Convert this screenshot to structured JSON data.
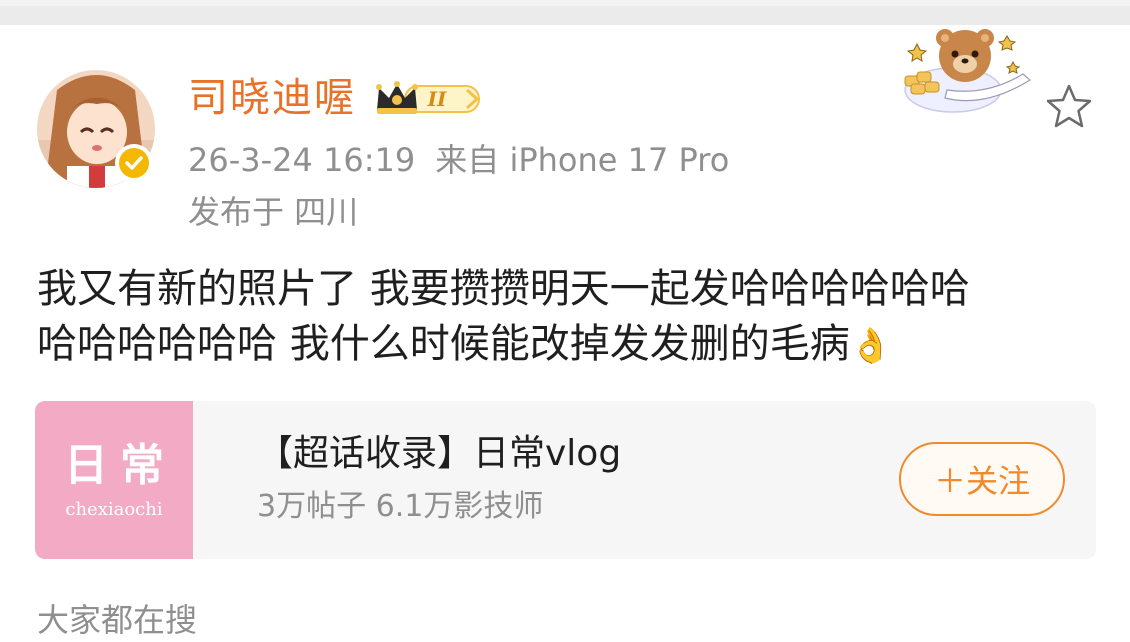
{
  "post": {
    "author": {
      "name": "司晓迪喔",
      "vip_level": "II",
      "verified": true
    },
    "meta": {
      "date": "26-3-24 16:19",
      "source": "来自 iPhone 17 Pro",
      "location": "发布于 四川"
    },
    "content": {
      "line1": "我又有新的照片了 我要攒攒明天一起发哈哈哈哈哈哈",
      "line2": "哈哈哈哈哈哈 我什么时候能改掉发发删的毛病",
      "emoji": "👌"
    },
    "topic": {
      "cover_title": "日常",
      "cover_subtitle": "chexiaochi",
      "name": "【超话收录】日常vlog",
      "stats": "3万帖子 6.1万影技师",
      "follow_label": "＋关注"
    }
  },
  "section": {
    "search_label": "大家都在搜"
  },
  "icons": {
    "star": "star-outline-icon",
    "verified": "verified-badge-icon",
    "vip": "crown-icon"
  },
  "colors": {
    "username": "#e8722a",
    "accent": "#f08a2b",
    "meta_text": "#8f8f8f",
    "body_text": "#1f1f1f",
    "card_bg": "#f6f6f6",
    "cover_bg": "#f3aac4",
    "verified": "#f5b800"
  }
}
